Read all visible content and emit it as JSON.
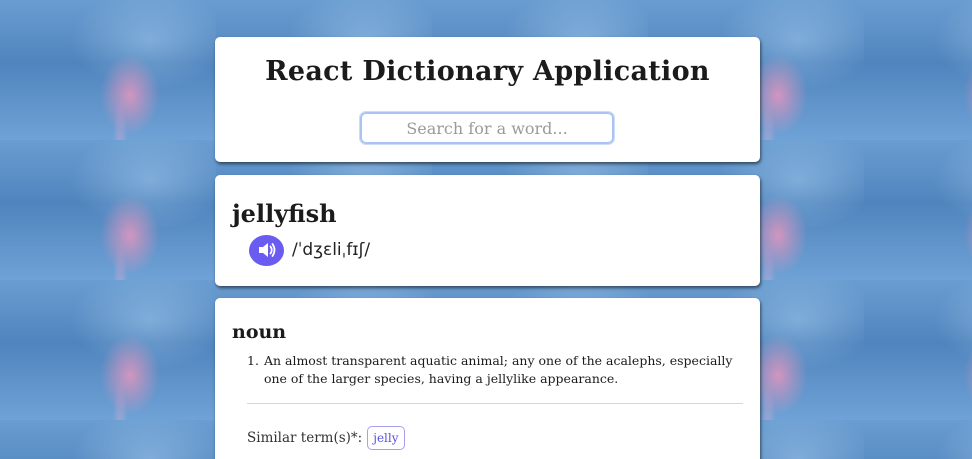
{
  "app": {
    "title": "React Dictionary Application"
  },
  "search": {
    "placeholder": "Search for a word..."
  },
  "entry": {
    "word": "jellyfish",
    "phonetic": "/ˈdʒɛliˌfɪʃ/"
  },
  "meaning": {
    "part_of_speech": "noun",
    "definitions": [
      {
        "number": "1.",
        "text": "An almost transparent aquatic animal; any one of the acalephs, especially one of the larger species, having a jellylike appearance."
      }
    ],
    "similar_label": "Similar term(s)*:",
    "similar_terms": [
      "jelly"
    ]
  },
  "colors": {
    "accent": "#6a5cf0",
    "chip_text": "#5a4fe0",
    "card": "#ffffff"
  },
  "icons": {
    "audio": "speaker-icon"
  }
}
